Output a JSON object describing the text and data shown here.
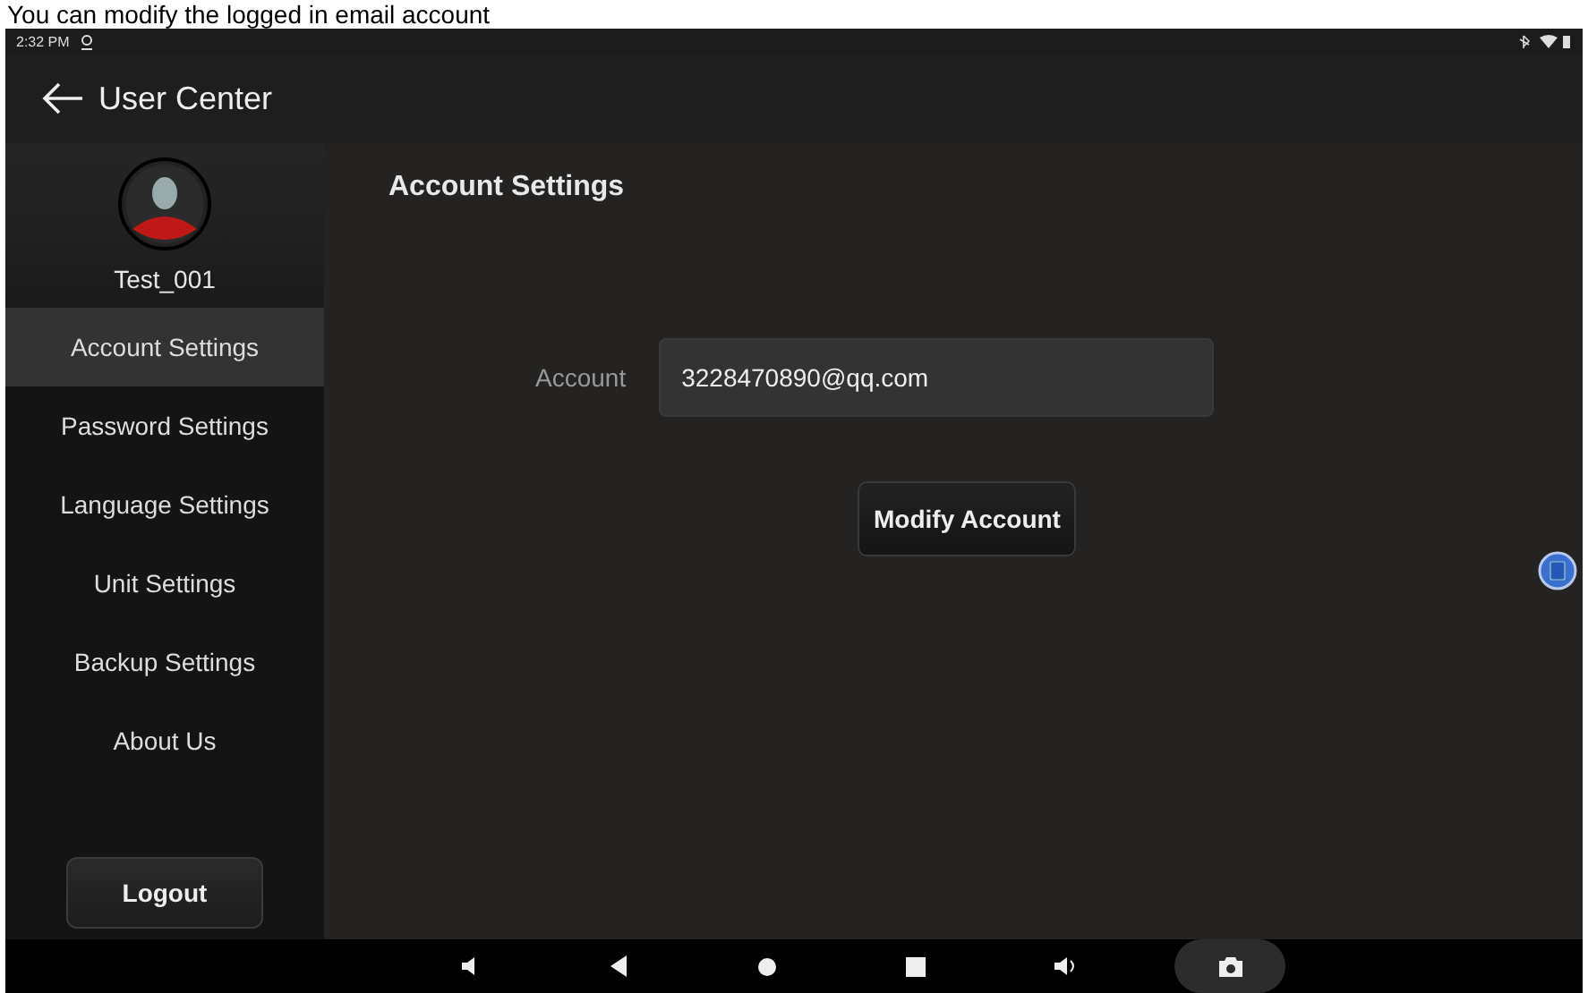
{
  "caption": "You can modify the logged in email account",
  "status_bar": {
    "time": "2:32 PM"
  },
  "header": {
    "title": "User Center"
  },
  "sidebar": {
    "username": "Test_001",
    "items": [
      {
        "label": "Account Settings",
        "selected": true
      },
      {
        "label": "Password Settings",
        "selected": false
      },
      {
        "label": "Language Settings",
        "selected": false
      },
      {
        "label": "Unit Settings",
        "selected": false
      },
      {
        "label": "Backup Settings",
        "selected": false
      },
      {
        "label": "About Us",
        "selected": false
      }
    ],
    "logout": "Logout"
  },
  "main": {
    "title": "Account Settings",
    "field_label": "Account",
    "field_value": "3228470890@qq.com",
    "button": "Modify Account"
  }
}
